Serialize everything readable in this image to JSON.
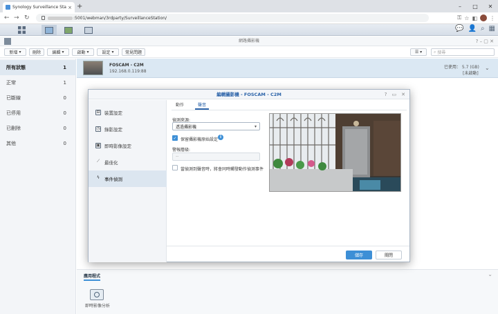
{
  "browser": {
    "tab_title": "Synology Surveillance Statio",
    "tab_close": "×",
    "new_tab": "+",
    "url": ":5001/webman/3rdparty/SurveillanceStation/",
    "win_min": "–",
    "win_max": "□",
    "win_close": "✕"
  },
  "window": {
    "title": "網路攝影機"
  },
  "toolbar": {
    "add": "新增",
    "delete": "刪除",
    "edit": "編輯",
    "action": "啟動",
    "config": "設定",
    "faq": "常見問題",
    "search_placeholder": "搜尋"
  },
  "sidebar": {
    "items": [
      {
        "label": "所有狀態",
        "count": "1"
      },
      {
        "label": "正常",
        "count": "1"
      },
      {
        "label": "已斷線",
        "count": "0"
      },
      {
        "label": "已停用",
        "count": "0"
      },
      {
        "label": "已刪除",
        "count": "0"
      },
      {
        "label": "其他",
        "count": "0"
      }
    ]
  },
  "camera": {
    "name": "FOSCAM - C2M",
    "ip": "192.168.0.119:88",
    "used": "已使用：  5.7 (GB)",
    "status": "[未啟動]"
  },
  "bottom_panel": {
    "tab": "應用程式",
    "app_label": "即時影像分析"
  },
  "modal": {
    "title": "編輯攝影機 - FOSCAM - C2M",
    "help": "?",
    "restore": "▭",
    "close": "✕",
    "nav": [
      {
        "label": "裝置設定",
        "icon": "⊟"
      },
      {
        "label": "錄影設定",
        "icon": "◷"
      },
      {
        "label": "即時影像設定",
        "icon": "▣"
      },
      {
        "label": "最佳化",
        "icon": "⟋"
      },
      {
        "label": "事件偵測",
        "icon": "ϟ"
      }
    ],
    "tabs": {
      "motion": "動作",
      "audio": "聲音"
    },
    "source_label": "偵測來源:",
    "source_value": "透過攝影機",
    "keep_label": "保留攝影機原始設定",
    "info": "i",
    "alarm_label": "警報層級:",
    "alarm_value": "--",
    "trigger_label": "當偵測到聲音時，將會同時觸發動作偵測事件",
    "check": "✓",
    "save": "儲存",
    "close_btn": "關閉"
  },
  "colors": {
    "accent": "#3d8fd6",
    "title_blue": "#2a62a8",
    "selected_row": "#dbe8f3"
  }
}
